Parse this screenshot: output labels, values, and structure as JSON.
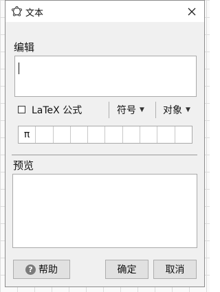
{
  "window": {
    "title": "文本",
    "close_symbol": "✕",
    "icon": "polygon-logo-icon"
  },
  "edit": {
    "section_label": "编辑",
    "latex_label": "LaTeX 公式",
    "latex_checked": false,
    "symbols_label": "符号",
    "objects_label": "对象",
    "symbol_palette": [
      "π",
      "",
      "",
      "",
      "",
      "",
      "",
      "",
      "",
      ""
    ]
  },
  "preview": {
    "section_label": "预览"
  },
  "buttons": {
    "help": "帮助",
    "ok": "确定",
    "cancel": "取消"
  }
}
